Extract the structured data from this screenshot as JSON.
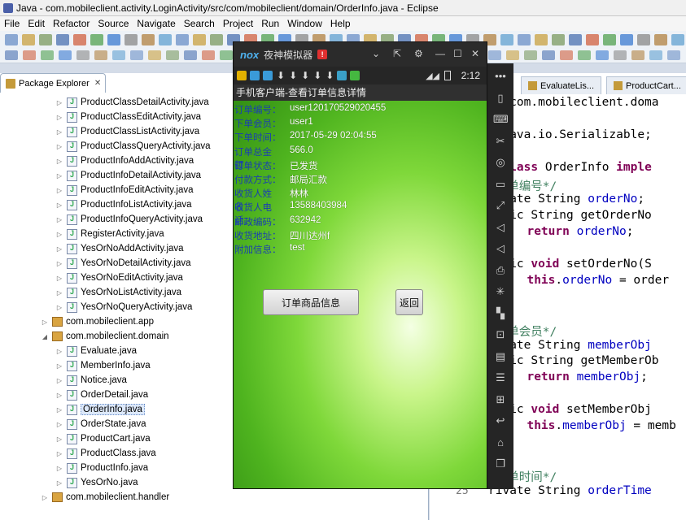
{
  "window": {
    "title": "Java - com.mobileclient.activity.LoginActivity/src/com/mobileclient/domain/OrderInfo.java - Eclipse"
  },
  "menu": [
    "File",
    "Edit",
    "Refactor",
    "Source",
    "Navigate",
    "Search",
    "Project",
    "Run",
    "Window",
    "Help"
  ],
  "package_explorer": {
    "tab_label": "Package Explorer",
    "close_glyph": "✕",
    "items": [
      {
        "type": "file",
        "label": "ProductClassDetailActivity.java",
        "depth": 3
      },
      {
        "type": "file",
        "label": "ProductClassEditActivity.java",
        "depth": 3
      },
      {
        "type": "file",
        "label": "ProductClassListActivity.java",
        "depth": 3
      },
      {
        "type": "file",
        "label": "ProductClassQueryActivity.java",
        "depth": 3
      },
      {
        "type": "file",
        "label": "ProductInfoAddActivity.java",
        "depth": 3
      },
      {
        "type": "file",
        "label": "ProductInfoDetailActivity.java",
        "depth": 3
      },
      {
        "type": "file",
        "label": "ProductInfoEditActivity.java",
        "depth": 3
      },
      {
        "type": "file",
        "label": "ProductInfoListActivity.java",
        "depth": 3
      },
      {
        "type": "file",
        "label": "ProductInfoQueryActivity.java",
        "depth": 3
      },
      {
        "type": "file",
        "label": "RegisterActivity.java",
        "depth": 3
      },
      {
        "type": "file",
        "label": "YesOrNoAddActivity.java",
        "depth": 3
      },
      {
        "type": "file",
        "label": "YesOrNoDetailActivity.java",
        "depth": 3
      },
      {
        "type": "file",
        "label": "YesOrNoEditActivity.java",
        "depth": 3
      },
      {
        "type": "file",
        "label": "YesOrNoListActivity.java",
        "depth": 3
      },
      {
        "type": "file",
        "label": "YesOrNoQueryActivity.java",
        "depth": 3
      },
      {
        "type": "package",
        "label": "com.mobileclient.app",
        "depth": 2,
        "toggle": "▷"
      },
      {
        "type": "package",
        "label": "com.mobileclient.domain",
        "depth": 2,
        "toggle": "◢"
      },
      {
        "type": "file",
        "label": "Evaluate.java",
        "depth": 3
      },
      {
        "type": "file",
        "label": "MemberInfo.java",
        "depth": 3
      },
      {
        "type": "file",
        "label": "Notice.java",
        "depth": 3
      },
      {
        "type": "file",
        "label": "OrderDetail.java",
        "depth": 3
      },
      {
        "type": "file",
        "label": "OrderInfo.java",
        "depth": 3,
        "selected": true
      },
      {
        "type": "file",
        "label": "OrderState.java",
        "depth": 3
      },
      {
        "type": "file",
        "label": "ProductCart.java",
        "depth": 3
      },
      {
        "type": "file",
        "label": "ProductClass.java",
        "depth": 3
      },
      {
        "type": "file",
        "label": "ProductInfo.java",
        "depth": 3
      },
      {
        "type": "file",
        "label": "YesOrNo.java",
        "depth": 3
      },
      {
        "type": "package",
        "label": "com.mobileclient.handler",
        "depth": 2,
        "toggle": "▷"
      }
    ]
  },
  "editor": {
    "tabs": [
      "EvaluateLis...",
      "ProductCart..."
    ],
    "line_number": "25",
    "lines": [
      {
        "html": "ge com.mobileclient.doma"
      },
      {
        "html": ""
      },
      {
        "html": "t java.io.Serializable;"
      },
      {
        "html": ""
      },
      {
        "html": "c class OrderInfo imple"
      },
      {
        "html": "*订单编号*/"
      },
      {
        "html": "rivate String orderNo;"
      },
      {
        "html": "ublic String getOrderNo"
      },
      {
        "html": "  return orderNo;"
      },
      {
        "html": ""
      },
      {
        "html": "ublic void setOrderNo(S"
      },
      {
        "html": "  this.orderNo = order"
      },
      {
        "html": ""
      },
      {
        "html": ""
      },
      {
        "html": "*下单会员*/"
      },
      {
        "html": "rivate String memberObj"
      },
      {
        "html": "ublic String getMemberOb"
      },
      {
        "html": "  return memberObj;"
      },
      {
        "html": ""
      },
      {
        "html": "ublic void setMemberObj"
      },
      {
        "html": "  this.memberObj = memb"
      },
      {
        "html": ""
      },
      {
        "html": ""
      },
      {
        "html": "*下单时间*/"
      },
      {
        "html": "rivate String orderTime"
      }
    ]
  },
  "emulator": {
    "logo": "nox",
    "name": "夜神模拟器",
    "badge": "!",
    "clock": "2:12",
    "app_title": "手机客户端-查看订单信息详情",
    "fields": [
      {
        "label": "订单编号：",
        "value": "user120170529020455"
      },
      {
        "label": "下单会员：",
        "value": "user1"
      },
      {
        "label": "下单时间：",
        "value": "2017-05-29 02:04:55"
      },
      {
        "label": "订单总金额：",
        "value": "566.0"
      },
      {
        "label": "订单状态：",
        "value": "已发货"
      },
      {
        "label": "付款方式：",
        "value": "邮局汇款"
      },
      {
        "label": "收货人姓名：",
        "value": "林林"
      },
      {
        "label": "收货人电话：",
        "value": "13588403984"
      },
      {
        "label": "邮政编码：",
        "value": "632942"
      },
      {
        "label": "收货地址：",
        "value": "四川达州f"
      },
      {
        "label": "附加信息：",
        "value": "test"
      }
    ],
    "order_items_button": "订单商品信息",
    "back_button": "返回"
  }
}
